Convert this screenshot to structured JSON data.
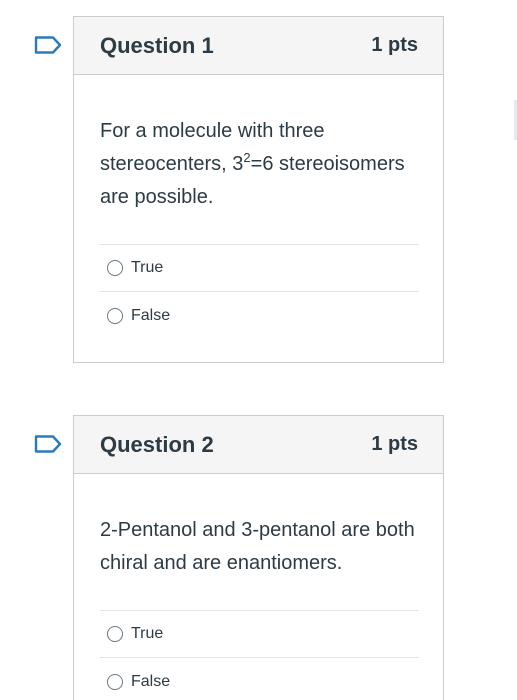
{
  "questions": [
    {
      "title": "Question 1",
      "points": "1 pts",
      "text_parts": {
        "before": "For a molecule with three stereocenters, 3",
        "superscript": "2",
        "after": "=6 stereoisomers are possible."
      },
      "answers": [
        {
          "label": "True",
          "selected": false
        },
        {
          "label": "False",
          "selected": false
        }
      ]
    },
    {
      "title": "Question 2",
      "points": "1 pts",
      "text": "2-Pentanol and 3-pentanol are both chiral and are enantiomers.",
      "answers": [
        {
          "label": "True",
          "selected": false
        },
        {
          "label": "False",
          "selected": false
        }
      ]
    }
  ],
  "colors": {
    "flag_outline": "#2b7abc",
    "header_bg": "#f5f5f5",
    "border": "#c7cdd1",
    "text": "#2d3b45"
  }
}
